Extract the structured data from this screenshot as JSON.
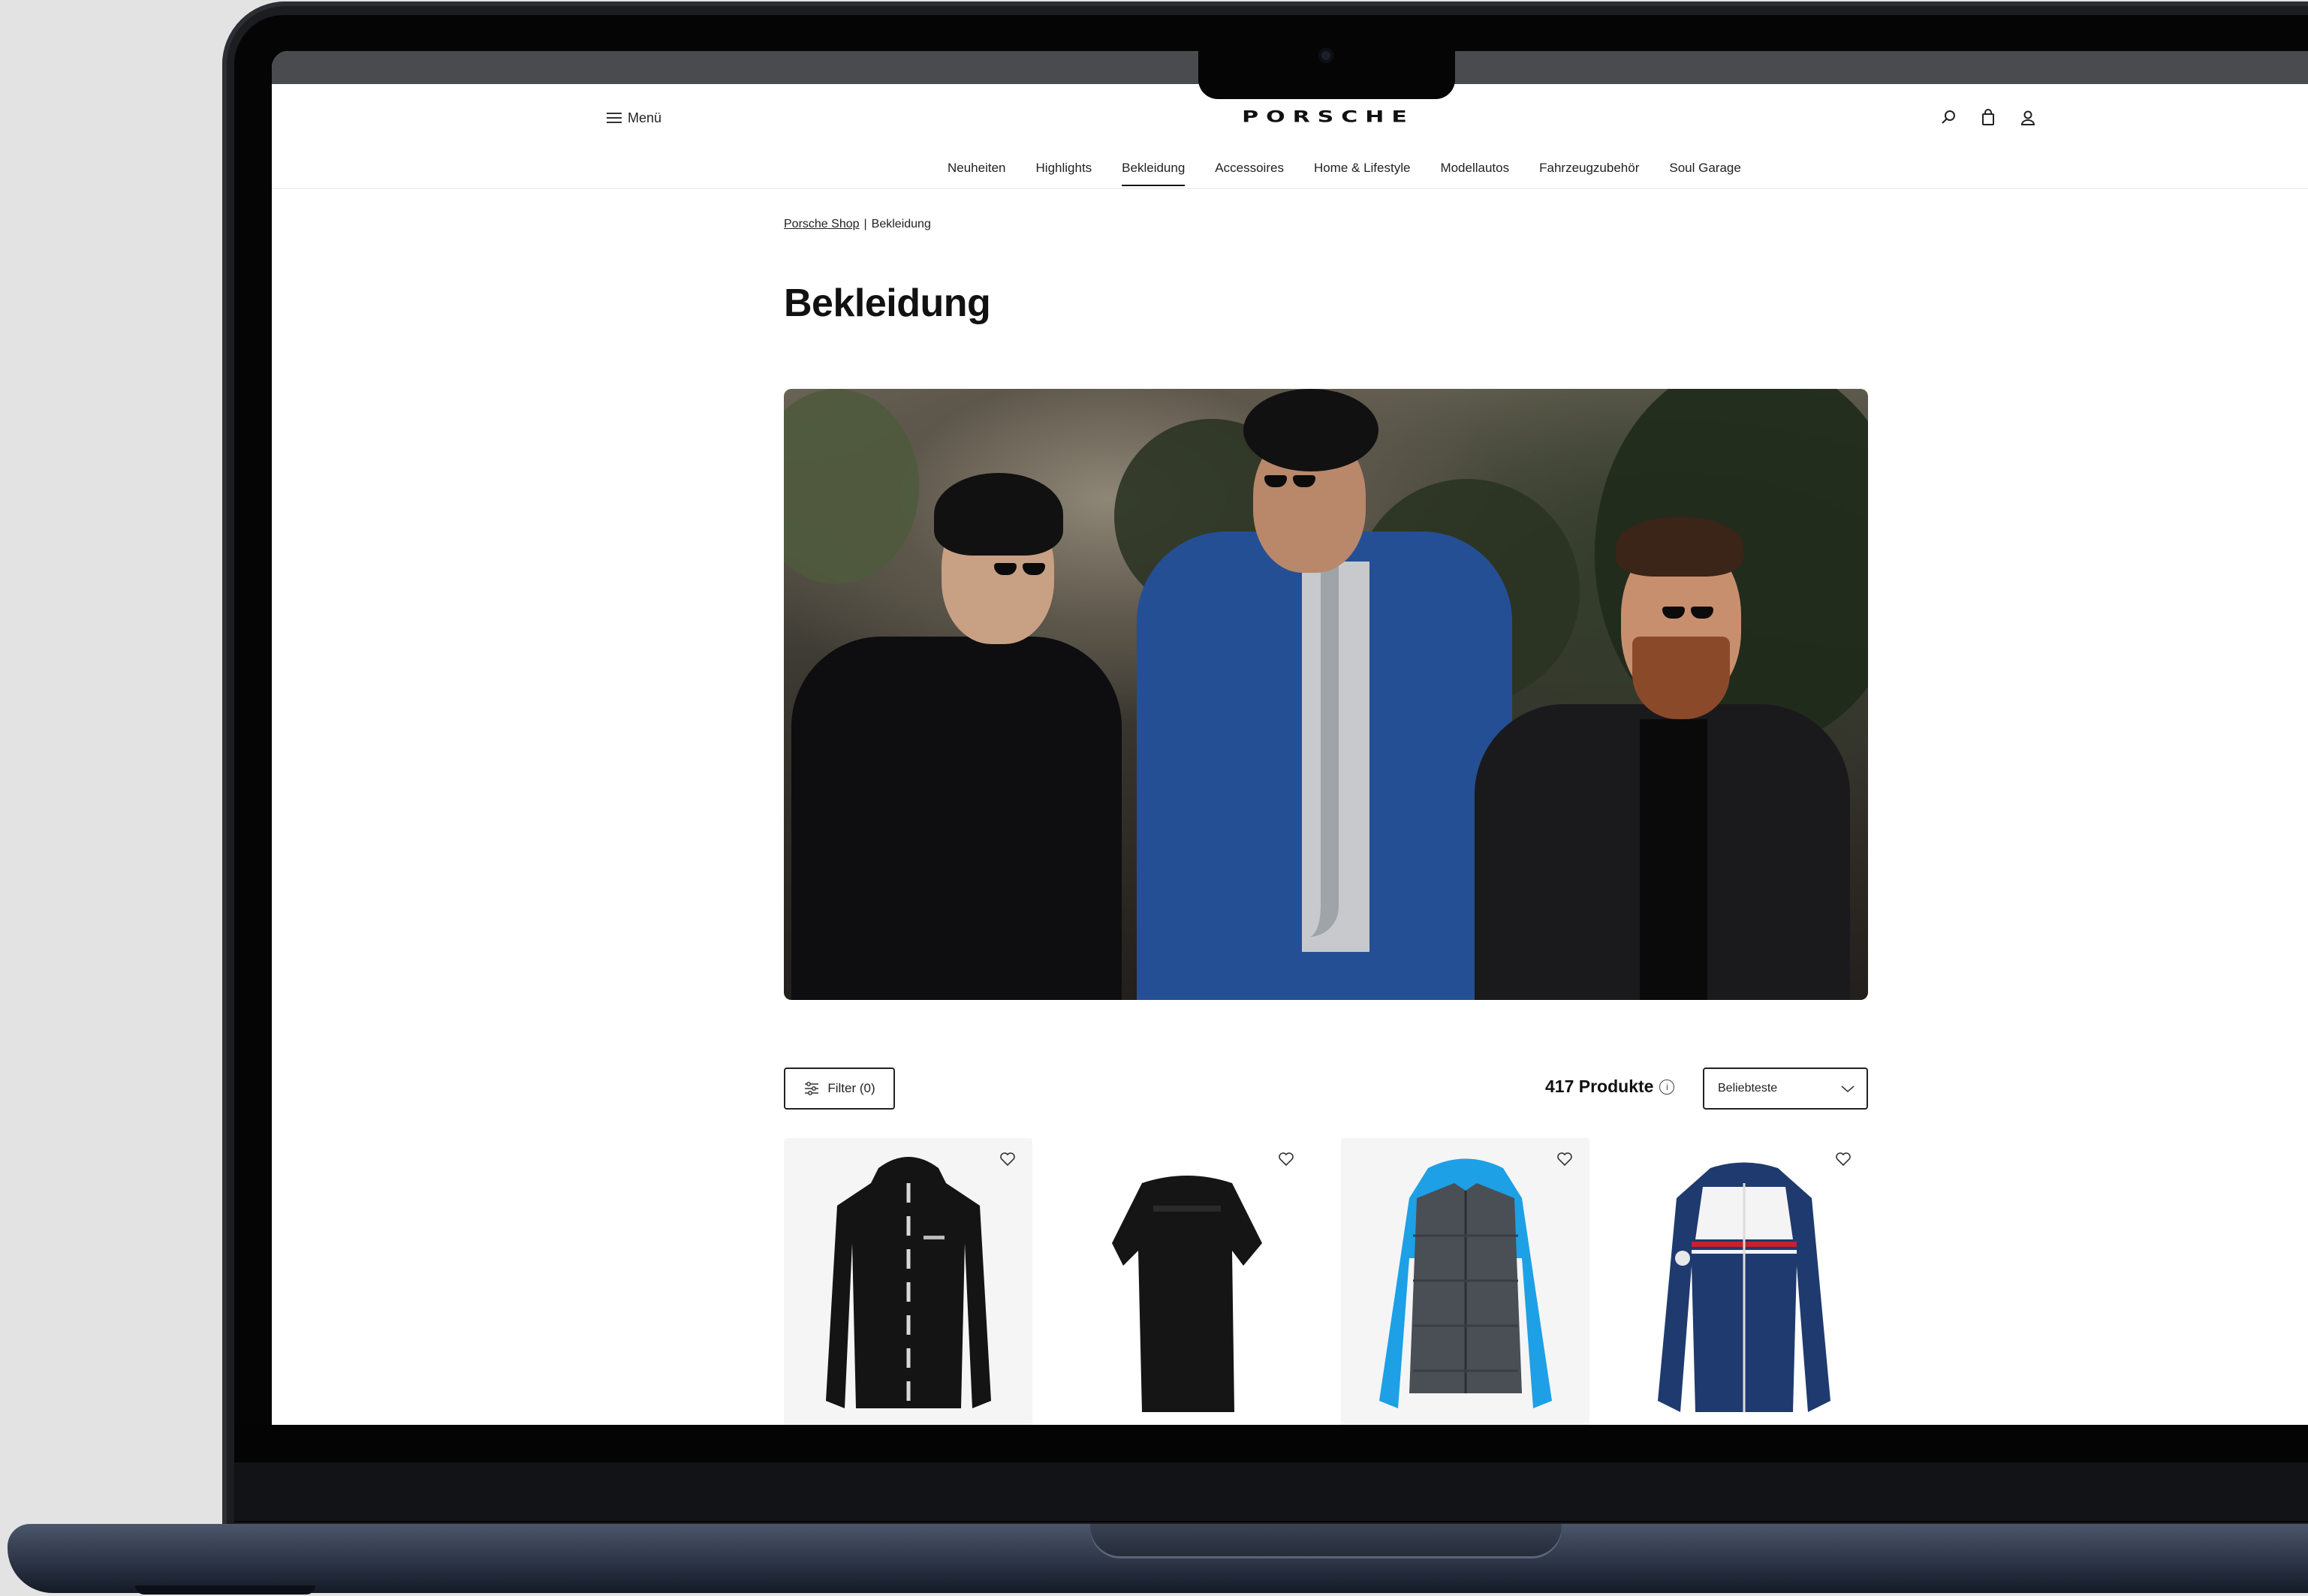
{
  "header": {
    "menu_label": "Menü",
    "logo_text": "PORSCHE"
  },
  "nav": {
    "items": [
      {
        "label": "Neuheiten"
      },
      {
        "label": "Highlights"
      },
      {
        "label": "Bekleidung",
        "active": true
      },
      {
        "label": "Accessoires"
      },
      {
        "label": "Home & Lifestyle"
      },
      {
        "label": "Modellautos"
      },
      {
        "label": "Fahrzeugzubehör"
      },
      {
        "label": "Soul Garage"
      }
    ]
  },
  "breadcrumb": {
    "root": "Porsche Shop",
    "separator": "|",
    "current": "Bekleidung"
  },
  "page": {
    "title": "Bekleidung"
  },
  "toolbar": {
    "filter_label": "Filter (0)",
    "product_count": "417 Produkte",
    "info_icon": "i",
    "sort_selected": "Beliebteste"
  },
  "products": [
    {
      "icon": "black-hoodie-jacket",
      "color": "#141414"
    },
    {
      "icon": "black-t-shirt",
      "color": "#151515"
    },
    {
      "icon": "blue-grey-puffer-vest",
      "color": "#1ea0e6"
    },
    {
      "icon": "navy-racing-jacket",
      "color": "#1f3a6e"
    }
  ],
  "colors": {
    "text": "#111111",
    "border": "#222222",
    "product_bg": "#f5f5f5"
  }
}
